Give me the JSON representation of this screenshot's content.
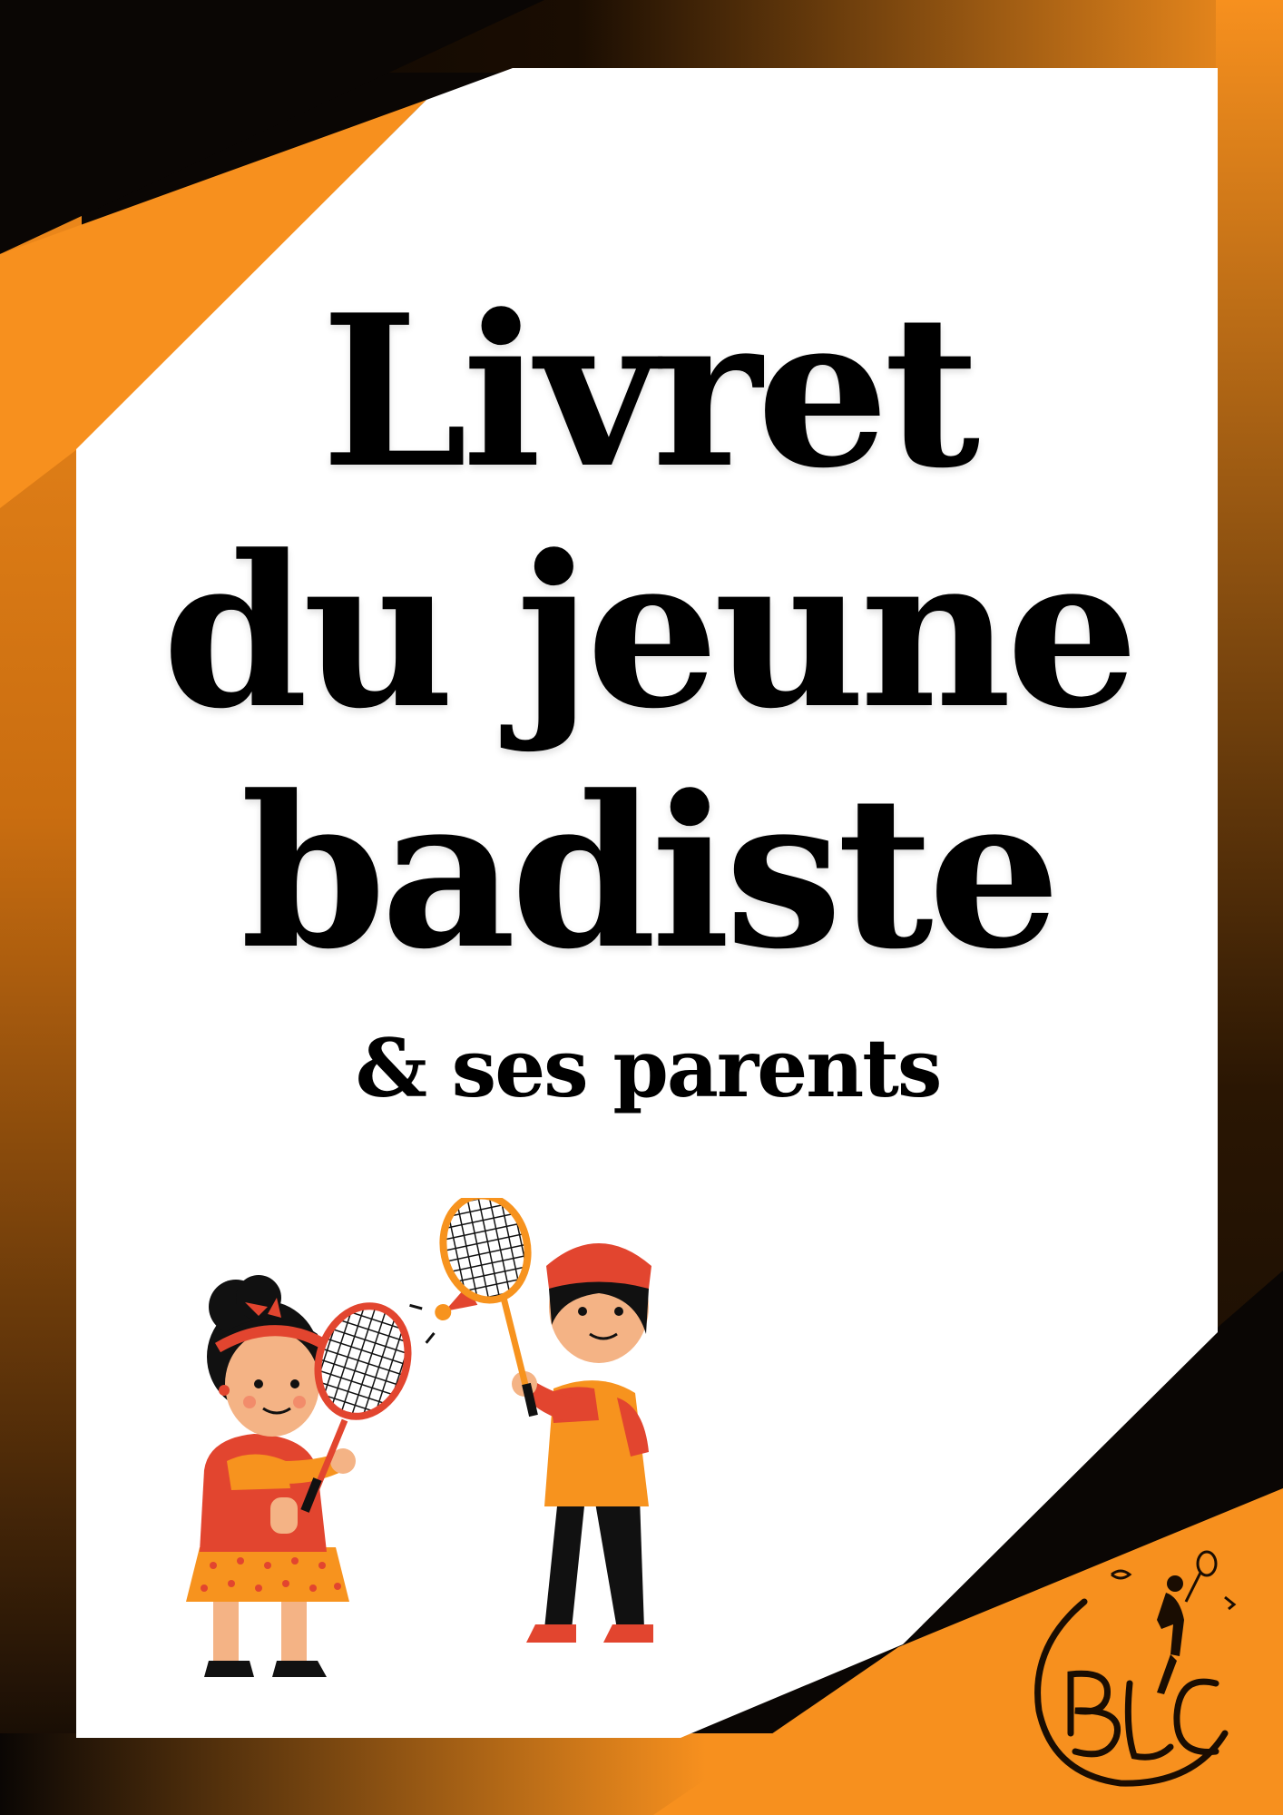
{
  "cover": {
    "title_lines": [
      "Livret",
      "du jeune",
      "badiste"
    ],
    "subtitle": "& ses parents"
  },
  "logo": {
    "icon": "club-logo-badminton-player"
  },
  "illustration": {
    "icon": "kids-playing-badminton"
  },
  "colors": {
    "orange": "#F7901E",
    "dark": "#0A0604",
    "white": "#FFFFFF",
    "red": "#E2452F",
    "text": "#000000"
  }
}
